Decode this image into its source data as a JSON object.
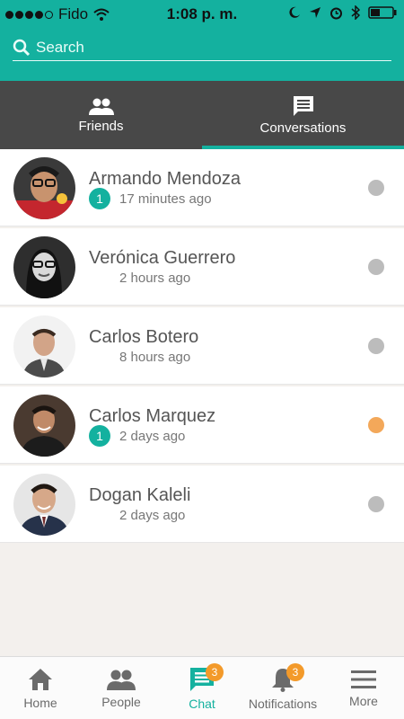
{
  "status_bar": {
    "carrier": "Fido",
    "time": "1:08 p. m."
  },
  "search": {
    "placeholder": "Search"
  },
  "tabs": [
    {
      "label": "Friends",
      "icon": "people-icon"
    },
    {
      "label": "Conversations",
      "icon": "chat-icon"
    }
  ],
  "conversations": [
    {
      "name": "Armando Mendoza",
      "unread": "1",
      "time": "17 minutes ago",
      "status_color": "#bcbcbc"
    },
    {
      "name": "Verónica Guerrero",
      "unread": "",
      "time": "2 hours ago",
      "status_color": "#bcbcbc"
    },
    {
      "name": "Carlos Botero",
      "unread": "",
      "time": "8 hours ago",
      "status_color": "#bcbcbc"
    },
    {
      "name": "Carlos Marquez",
      "unread": "1",
      "time": "2 days ago",
      "status_color": "#f3a85a"
    },
    {
      "name": "Dogan Kaleli",
      "unread": "",
      "time": "2 days ago",
      "status_color": "#bcbcbc"
    }
  ],
  "bottom_nav": [
    {
      "label": "Home",
      "icon": "home-icon"
    },
    {
      "label": "People",
      "icon": "people-icon"
    },
    {
      "label": "Chat",
      "icon": "chat-icon",
      "badge": "3"
    },
    {
      "label": "Notifications",
      "icon": "bell-icon",
      "badge": "3"
    },
    {
      "label": "More",
      "icon": "menu-icon"
    }
  ],
  "colors": {
    "accent": "#14b19f",
    "tab_bar": "#484848",
    "online_dot": "#f3a85a",
    "badge": "#f39a2a"
  }
}
